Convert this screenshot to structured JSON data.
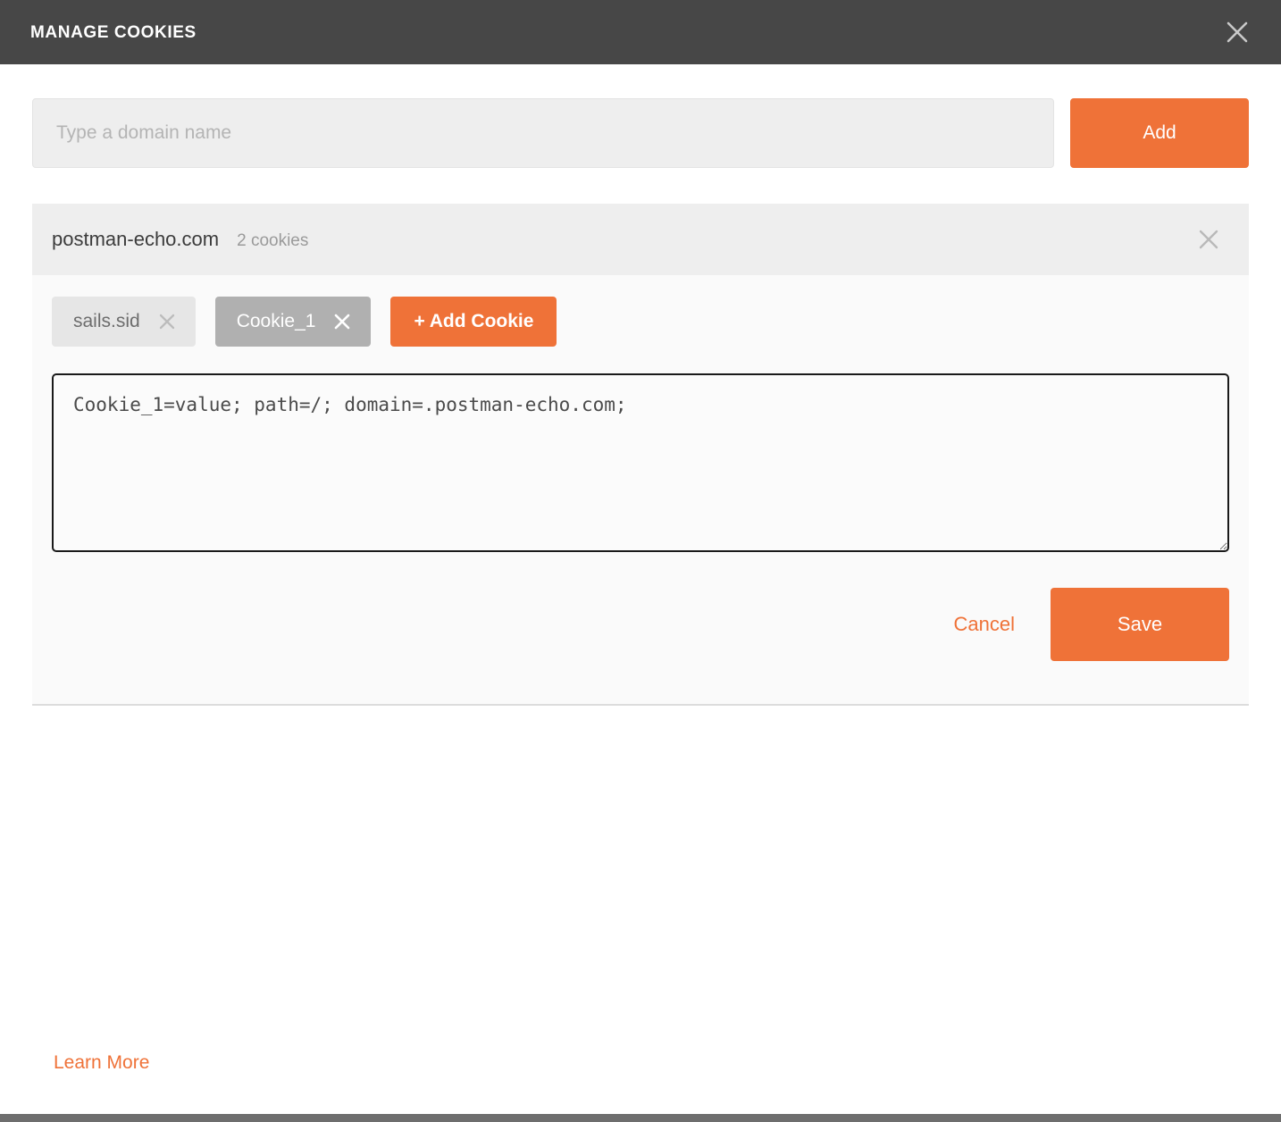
{
  "header": {
    "title": "MANAGE COOKIES",
    "close_icon": "close-icon"
  },
  "domain_add": {
    "placeholder": "Type a domain name",
    "value": "",
    "add_label": "Add"
  },
  "domain_panel": {
    "name": "postman-echo.com",
    "cookie_count_label": "2 cookies",
    "remove_icon": "close-icon",
    "cookies": [
      {
        "name": "sails.sid",
        "active": false,
        "remove_icon": "close-icon"
      },
      {
        "name": "Cookie_1",
        "active": true,
        "remove_icon": "close-icon"
      }
    ],
    "add_cookie_label": "+ Add Cookie",
    "editor_value": "Cookie_1=value; path=/; domain=.postman-echo.com;",
    "cancel_label": "Cancel",
    "save_label": "Save"
  },
  "footer": {
    "learn_more_label": "Learn More"
  },
  "colors": {
    "accent_orange": "#ef7238",
    "header_dark": "#474747",
    "chip_active": "#b0b0b0",
    "chip_inactive": "#e6e6e6"
  }
}
